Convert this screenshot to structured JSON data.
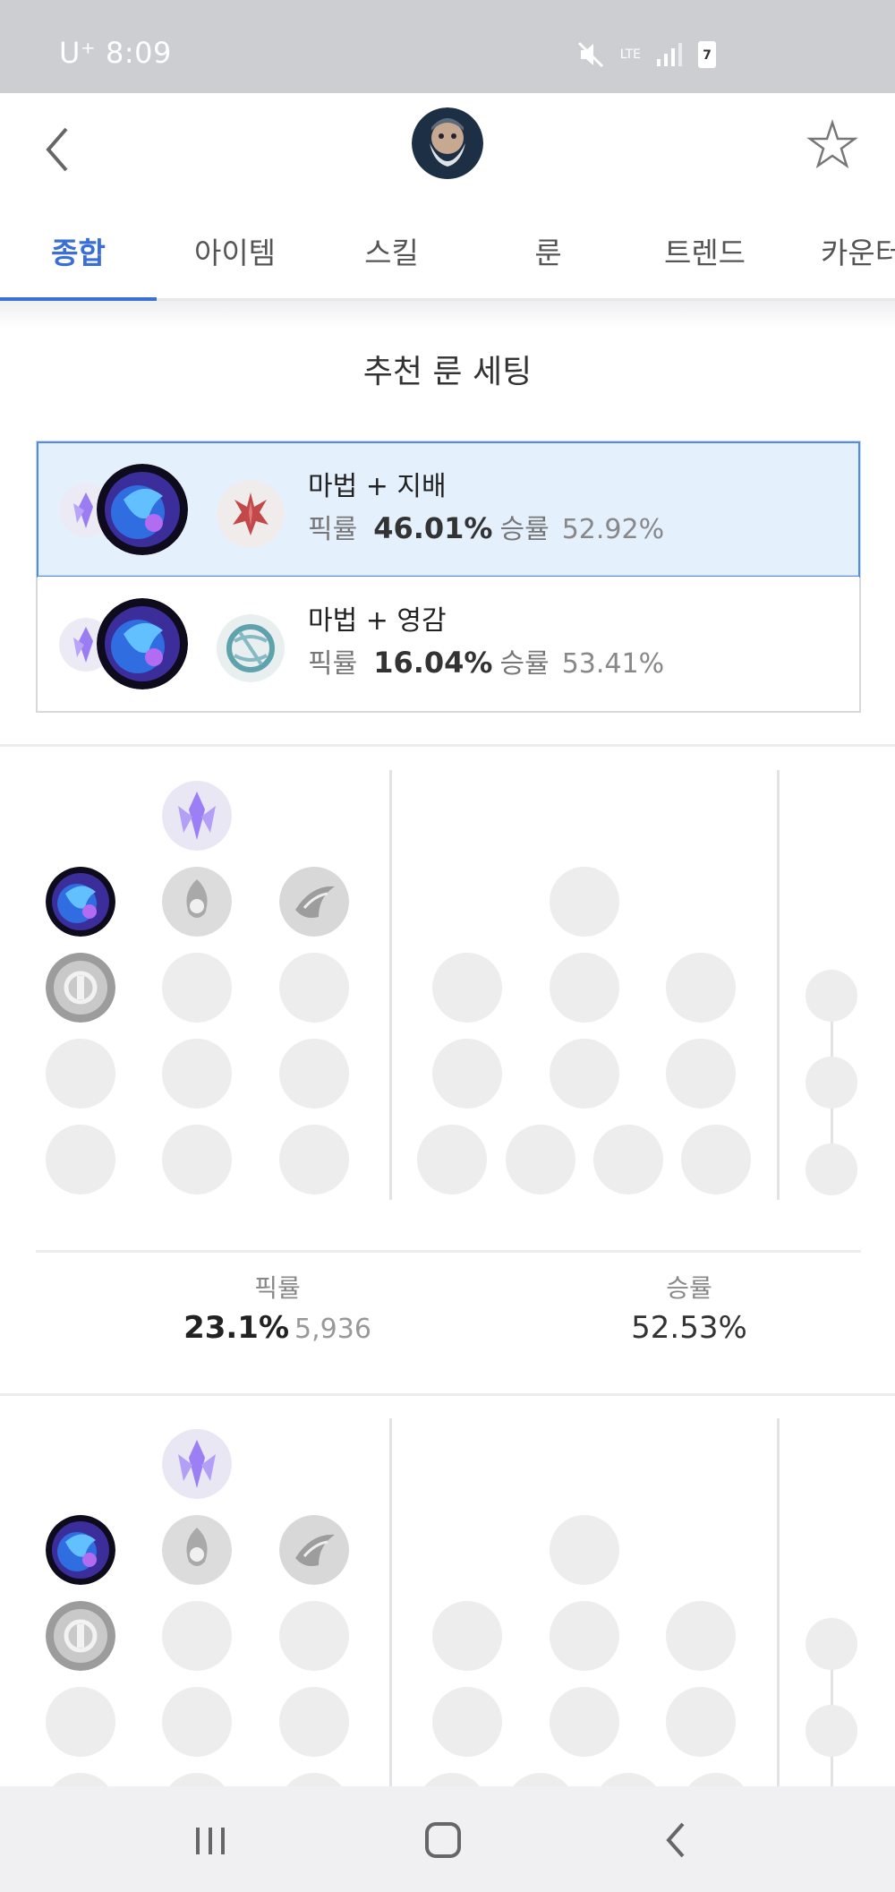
{
  "status_bar": {
    "carrier": "U⁺",
    "time": "8:09",
    "network": "LTE",
    "battery": "7"
  },
  "header": {
    "champion_avatar": "champion-portrait"
  },
  "tabs": [
    {
      "label": "종합",
      "active": true
    },
    {
      "label": "아이템",
      "active": false
    },
    {
      "label": "스킬",
      "active": false
    },
    {
      "label": "룬",
      "active": false
    },
    {
      "label": "트렌드",
      "active": false
    },
    {
      "label": "카운터",
      "active": false
    }
  ],
  "section": {
    "title": "추천 룬 세팅"
  },
  "rune_sets": [
    {
      "name": "마법 + 지배",
      "pick_label": "픽률",
      "pick_rate": "46.01%",
      "win_label": "승률",
      "win_rate": "52.92%",
      "secondary": "domination"
    },
    {
      "name": "마법 + 영감",
      "pick_label": "픽률",
      "pick_rate": "16.04%",
      "win_label": "승률",
      "win_rate": "53.41%",
      "secondary": "inspiration"
    }
  ],
  "page_stats": [
    {
      "pick_label": "픽률",
      "pick_rate": "23.1%",
      "pick_count": "5,936",
      "win_label": "승률",
      "win_rate": "52.53%"
    }
  ],
  "colors": {
    "accent": "#3a6fd8",
    "selected_bg": "#e5f0fd",
    "sorcery": "#8a6cf0"
  },
  "nav": {
    "icons": [
      "recent-apps-icon",
      "home-icon",
      "back-icon"
    ]
  }
}
